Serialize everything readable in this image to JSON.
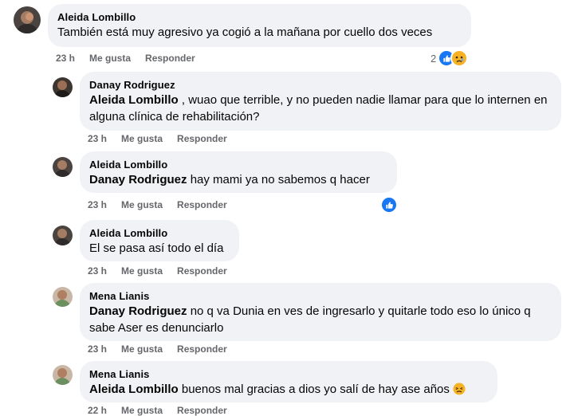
{
  "comments": [
    {
      "author": "Aleida Lombillo",
      "mention": "",
      "text": "También está muy agresivo ya cogió a la mañana por cuello dos veces",
      "time": "23 h",
      "like_label": "Me gusta",
      "reply_label": "Responder",
      "reaction_count": "2"
    },
    {
      "author": "Danay Rodriguez",
      "mention": "Aleida Lombillo",
      "text": " , wuao que terrible, y no pueden nadie llamar para que lo internen en alguna clínica de rehabilitación?",
      "time": "23 h",
      "like_label": "Me gusta",
      "reply_label": "Responder"
    },
    {
      "author": "Aleida Lombillo",
      "mention": "Danay Rodriguez",
      "text": " hay mami ya no sabemos q hacer",
      "time": "23 h",
      "like_label": "Me gusta",
      "reply_label": "Responder"
    },
    {
      "author": "Aleida Lombillo",
      "mention": "",
      "text": "El se pasa así todo el día",
      "time": "23 h",
      "like_label": "Me gusta",
      "reply_label": "Responder"
    },
    {
      "author": "Mena Lianis",
      "mention": "Danay Rodriguez",
      "text": " no q va Dunia en ves de ingresarlo y quitarle todo eso lo único q sabe Aser es denunciarlo",
      "time": "23 h",
      "like_label": "Me gusta",
      "reply_label": "Responder"
    },
    {
      "author": "Mena Lianis",
      "mention": "Aleida Lombillo",
      "text": " buenos mal gracias a dios yo salí de hay ase años",
      "time": "22 h",
      "like_label": "Me gusta",
      "reply_label": "Responder"
    }
  ],
  "icons": {
    "like": "like-reaction-icon",
    "sad": "sad-reaction-icon",
    "emoji": "tired-face-emoji"
  },
  "colors": {
    "bubble": "#f0f2f5",
    "meta": "#65676b",
    "like_blue": "#1877f2",
    "sad_yellow": "#f7b125"
  }
}
